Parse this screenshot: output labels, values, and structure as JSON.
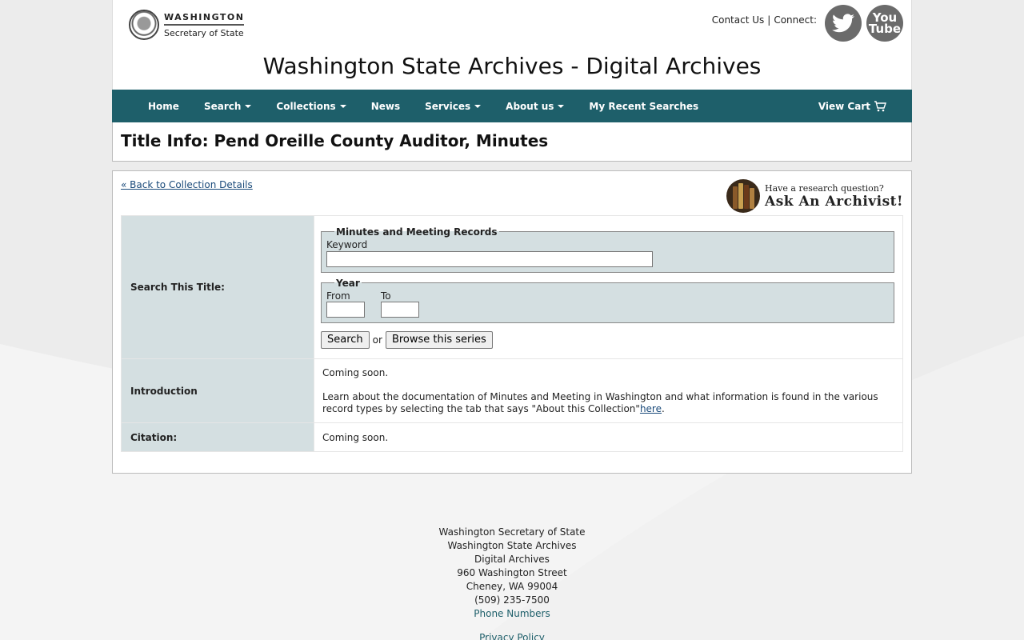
{
  "header": {
    "logo_line1": "WASHINGTON",
    "logo_line2": "Secretary of State",
    "contact_label": "Contact Us",
    "connect_label": "Connect:",
    "youtube_label_1": "You",
    "youtube_label_2": "Tube",
    "site_title": "Washington State Archives - Digital Archives"
  },
  "nav": {
    "items": [
      {
        "label": "Home",
        "dropdown": false
      },
      {
        "label": "Search",
        "dropdown": true
      },
      {
        "label": "Collections",
        "dropdown": true
      },
      {
        "label": "News",
        "dropdown": false
      },
      {
        "label": "Services",
        "dropdown": true
      },
      {
        "label": "About us",
        "dropdown": true
      },
      {
        "label": "My Recent Searches",
        "dropdown": false
      }
    ],
    "cart_label": "View Cart"
  },
  "page": {
    "title": "Title Info: Pend Oreille County Auditor, Minutes",
    "back_link": "« Back to Collection Details",
    "archivist_line1": "Have a research question?",
    "archivist_line2": "Ask An Archivist!"
  },
  "search_form": {
    "row_label": "Search This Title:",
    "fieldset_title": "Minutes and Meeting Records",
    "keyword_label": "Keyword",
    "keyword_value": "",
    "year_legend": "Year",
    "from_label": "From",
    "to_label": "To",
    "from_value": "",
    "to_value": "",
    "search_button": "Search",
    "or_text": "or",
    "browse_button": "Browse this series"
  },
  "introduction": {
    "label": "Introduction",
    "line1": "Coming soon.",
    "line2": "Learn about the documentation of Minutes and Meeting in Washington and what information is found in the various record types by selecting the tab that says \"About this Collection\"",
    "link": "here",
    "suffix": "."
  },
  "citation": {
    "label": "Citation:",
    "value": "Coming soon."
  },
  "footer": {
    "line1": "Washington Secretary of State",
    "line2": "Washington State Archives",
    "line3": "Digital Archives",
    "line4": "960 Washington Street",
    "line5": "Cheney, WA 99004",
    "line6": "(509) 235-7500",
    "phone_link": "Phone Numbers",
    "privacy_link": "Privacy Policy"
  },
  "colors": {
    "nav_bg": "#1e5f6a",
    "label_bg": "#d4dfe1",
    "link": "#1a4a7a"
  }
}
